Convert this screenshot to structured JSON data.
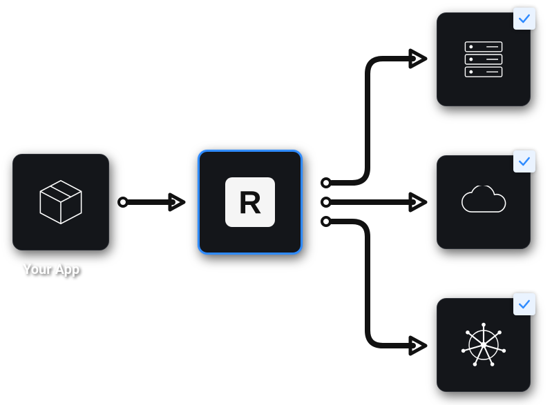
{
  "nodes": {
    "app": {
      "label": "Your App",
      "icon": "package-icon"
    },
    "runtime": {
      "label": "R",
      "icon": "r-logo"
    },
    "targets": [
      {
        "icon": "server-icon",
        "checked": true
      },
      {
        "icon": "cloud-icon",
        "checked": true
      },
      {
        "icon": "kubernetes-icon",
        "checked": true
      }
    ]
  },
  "colors": {
    "accent": "#2f8bff",
    "card_bg": "#14161a",
    "stroke": "#ffffff",
    "check_bg": "#eaf3ff",
    "check_mark": "#2f8bff"
  }
}
